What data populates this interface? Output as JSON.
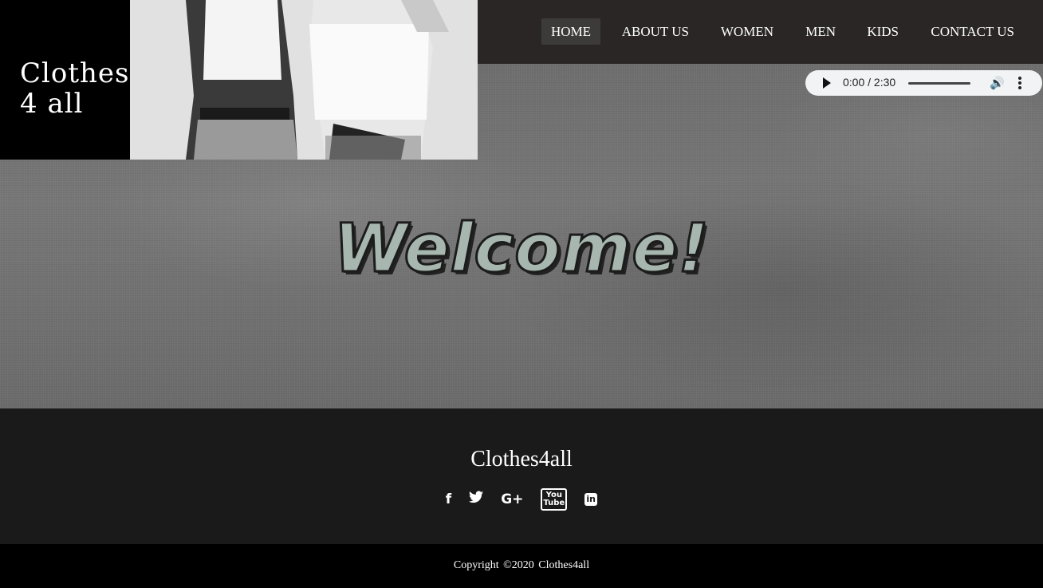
{
  "brand": {
    "logo_line1": "Clothes",
    "logo_line2": "4  all"
  },
  "nav": {
    "items": [
      {
        "label": "HOME",
        "active": true
      },
      {
        "label": "ABOUT US"
      },
      {
        "label": "WOMEN"
      },
      {
        "label": "MEN"
      },
      {
        "label": "KIDS"
      },
      {
        "label": "CONTACT US"
      }
    ]
  },
  "audio": {
    "time": "0:00 / 2:30"
  },
  "hero": {
    "title": "Welcome!"
  },
  "footer": {
    "title": "Clothes4all",
    "social": [
      {
        "icon": "facebook-icon",
        "glyph": "f"
      },
      {
        "icon": "twitter-icon",
        "glyph": "🐦"
      },
      {
        "icon": "google-plus-icon",
        "glyph": "G+"
      },
      {
        "icon": "youtube-icon",
        "glyph": "You Tube"
      },
      {
        "icon": "linkedin-icon",
        "glyph": "in"
      }
    ],
    "copyright": "Copyright ©2020 Clothes4all"
  }
}
